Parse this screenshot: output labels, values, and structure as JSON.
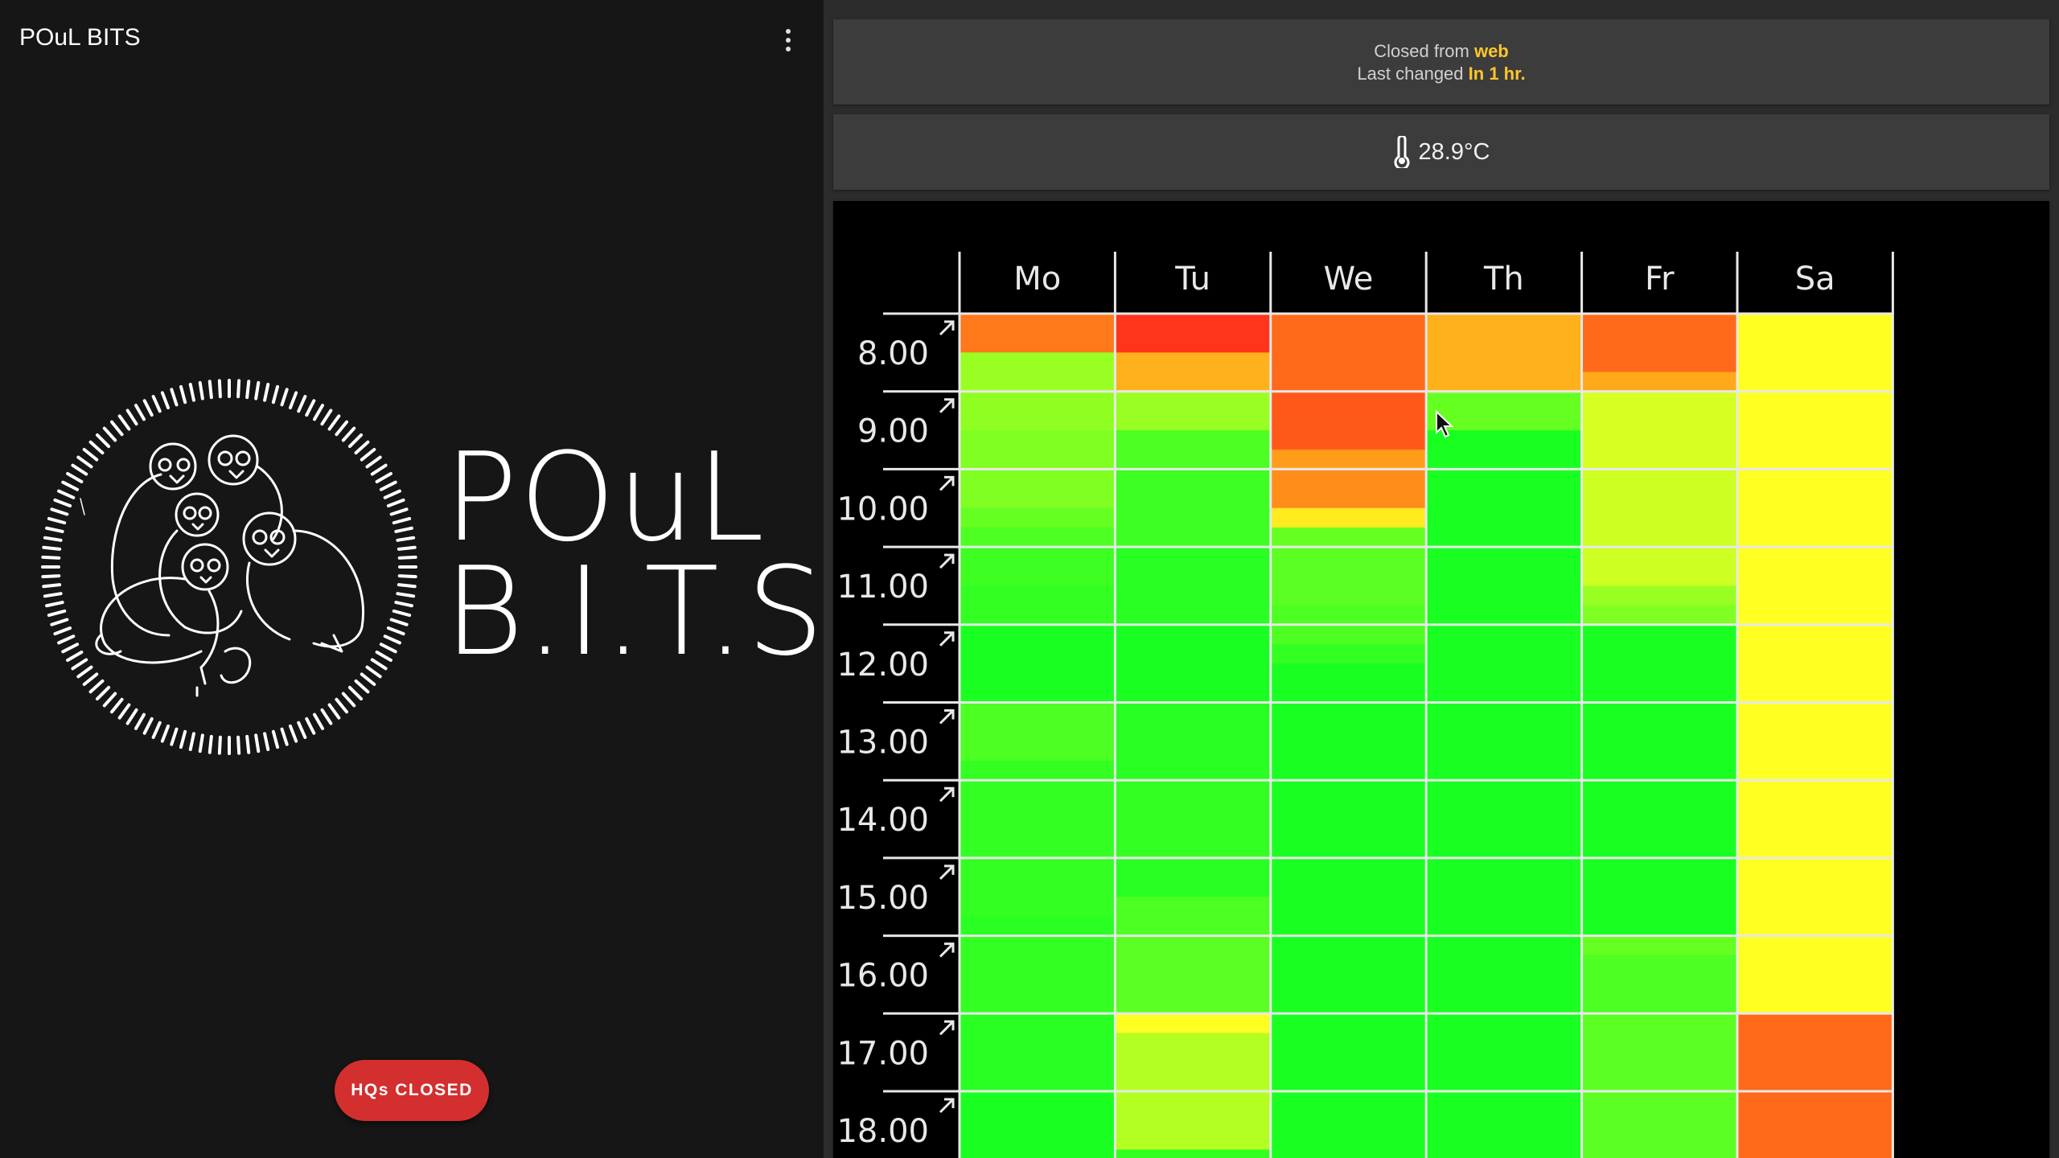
{
  "app": {
    "title": "POuL BITS"
  },
  "brand": {
    "line1": "POuL",
    "line2": "B.I.T.S."
  },
  "hq_button": {
    "label": "HQs CLOSED",
    "color": "#d32f2f"
  },
  "status": {
    "closed_prefix": "Closed from ",
    "closed_source": "web",
    "changed_prefix": "Last changed ",
    "changed_value": "In 1 hr.",
    "highlight_color": "#ffc72c"
  },
  "temperature": {
    "value": "28.9°C",
    "icon": "thermometer-icon"
  },
  "chart_data": {
    "type": "heatmap",
    "days": [
      "Mo",
      "Tu",
      "We",
      "Th",
      "Fr",
      "Sa"
    ],
    "hours": [
      "8.00",
      "9.00",
      "10.00",
      "11.00",
      "12.00",
      "13.00",
      "14.00",
      "15.00",
      "16.00",
      "17.00",
      "18.00"
    ],
    "subdivisions_per_hour": 4,
    "color_scale": {
      "0": "#00ff22",
      "0.5": "#ffff22",
      "0.75": "#ff9d1a",
      "1": "#ff1a1a"
    },
    "values": [
      [
        [
          0.82,
          0.82,
          0.3,
          0.3
        ],
        [
          0.28,
          0.28,
          0.25,
          0.25
        ],
        [
          0.25,
          0.25,
          0.2,
          0.15
        ],
        [
          0.12,
          0.12,
          0.1,
          0.1
        ],
        [
          0.05,
          0.05,
          0.05,
          0.05
        ],
        [
          0.15,
          0.15,
          0.15,
          0.1
        ],
        [
          0.1,
          0.1,
          0.1,
          0.1
        ],
        [
          0.1,
          0.1,
          0.1,
          0.08
        ],
        [
          0.1,
          0.1,
          0.1,
          0.1
        ],
        [
          0.08,
          0.08,
          0.08,
          0.08
        ],
        [
          0.05,
          0.05,
          0.05,
          0.05
        ]
      ],
      [
        [
          0.95,
          0.95,
          0.7,
          0.7
        ],
        [
          0.3,
          0.3,
          0.15,
          0.15
        ],
        [
          0.12,
          0.12,
          0.12,
          0.12
        ],
        [
          0.08,
          0.08,
          0.08,
          0.08
        ],
        [
          0.05,
          0.05,
          0.05,
          0.05
        ],
        [
          0.08,
          0.08,
          0.08,
          0.08
        ],
        [
          0.1,
          0.1,
          0.1,
          0.1
        ],
        [
          0.08,
          0.08,
          0.15,
          0.15
        ],
        [
          0.18,
          0.18,
          0.18,
          0.18
        ],
        [
          0.5,
          0.35,
          0.35,
          0.35
        ],
        [
          0.35,
          0.35,
          0.35,
          0.1
        ]
      ],
      [
        [
          0.85,
          0.85,
          0.85,
          0.85
        ],
        [
          0.88,
          0.88,
          0.88,
          0.75
        ],
        [
          0.78,
          0.78,
          0.55,
          0.2
        ],
        [
          0.18,
          0.18,
          0.18,
          0.15
        ],
        [
          0.15,
          0.1,
          0.05,
          0.05
        ],
        [
          0.05,
          0.05,
          0.05,
          0.05
        ],
        [
          0.05,
          0.05,
          0.05,
          0.05
        ],
        [
          0.05,
          0.05,
          0.05,
          0.05
        ],
        [
          0.05,
          0.05,
          0.05,
          0.05
        ],
        [
          0.05,
          0.05,
          0.05,
          0.05
        ],
        [
          0.05,
          0.05,
          0.05,
          0.05
        ]
      ],
      [
        [
          0.7,
          0.7,
          0.7,
          0.7
        ],
        [
          0.2,
          0.2,
          0.05,
          0.05
        ],
        [
          0.05,
          0.05,
          0.05,
          0.05
        ],
        [
          0.05,
          0.05,
          0.05,
          0.05
        ],
        [
          0.05,
          0.05,
          0.05,
          0.05
        ],
        [
          0.05,
          0.05,
          0.05,
          0.05
        ],
        [
          0.05,
          0.05,
          0.05,
          0.05
        ],
        [
          0.05,
          0.05,
          0.05,
          0.05
        ],
        [
          0.05,
          0.05,
          0.05,
          0.05
        ],
        [
          0.05,
          0.05,
          0.05,
          0.05
        ],
        [
          0.05,
          0.05,
          0.05,
          0.05
        ]
      ],
      [
        [
          0.85,
          0.85,
          0.85,
          0.72
        ],
        [
          0.42,
          0.42,
          0.42,
          0.42
        ],
        [
          0.4,
          0.4,
          0.4,
          0.4
        ],
        [
          0.4,
          0.4,
          0.3,
          0.25
        ],
        [
          0.05,
          0.05,
          0.05,
          0.05
        ],
        [
          0.05,
          0.05,
          0.05,
          0.05
        ],
        [
          0.05,
          0.05,
          0.05,
          0.05
        ],
        [
          0.05,
          0.05,
          0.05,
          0.05
        ],
        [
          0.2,
          0.15,
          0.15,
          0.15
        ],
        [
          0.18,
          0.18,
          0.18,
          0.18
        ],
        [
          0.18,
          0.18,
          0.18,
          0.18
        ]
      ],
      [
        [
          0.5,
          0.5,
          0.5,
          0.5
        ],
        [
          0.5,
          0.5,
          0.5,
          0.5
        ],
        [
          0.5,
          0.5,
          0.5,
          0.5
        ],
        [
          0.5,
          0.5,
          0.5,
          0.5
        ],
        [
          0.5,
          0.5,
          0.5,
          0.5
        ],
        [
          0.5,
          0.5,
          0.5,
          0.5
        ],
        [
          0.5,
          0.5,
          0.5,
          0.5
        ],
        [
          0.5,
          0.5,
          0.5,
          0.5
        ],
        [
          0.5,
          0.5,
          0.5,
          0.5
        ],
        [
          0.85,
          0.85,
          0.85,
          0.85
        ],
        [
          0.85,
          0.85,
          0.85,
          0.85
        ]
      ]
    ]
  }
}
